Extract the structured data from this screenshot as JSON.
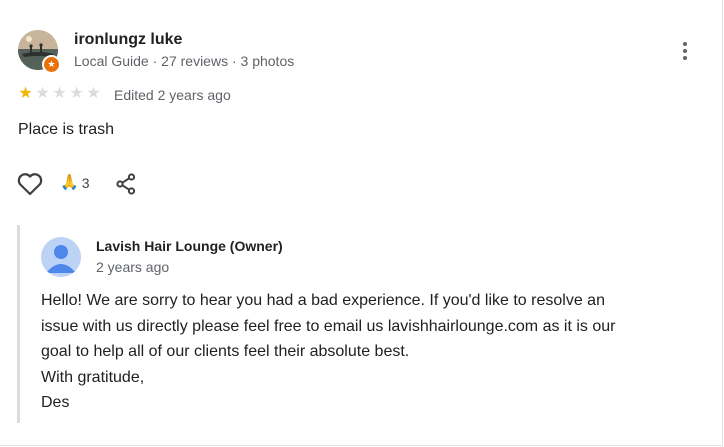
{
  "review": {
    "author": "ironlungz luke",
    "meta": "Local Guide · 27 reviews · 3 photos",
    "rating": 1,
    "max_rating": 5,
    "edited": "Edited 2 years ago",
    "text": "Place is trash",
    "reaction_emoji": "🙏",
    "reaction_count": "3",
    "badge_icon": "star-icon",
    "accent_color": "#e8710a",
    "star_color": "#f4b400"
  },
  "reply": {
    "owner": "Lavish Hair Lounge (Owner)",
    "date": "2 years ago",
    "lines": [
      "Hello! We are sorry to hear you had a bad experience. If you'd like to resolve an",
      "issue with us directly please feel free to email us lavishhairlounge.com as it is our",
      "goal to help all of our clients feel their absolute best.",
      "With gratitude,",
      "Des"
    ]
  }
}
